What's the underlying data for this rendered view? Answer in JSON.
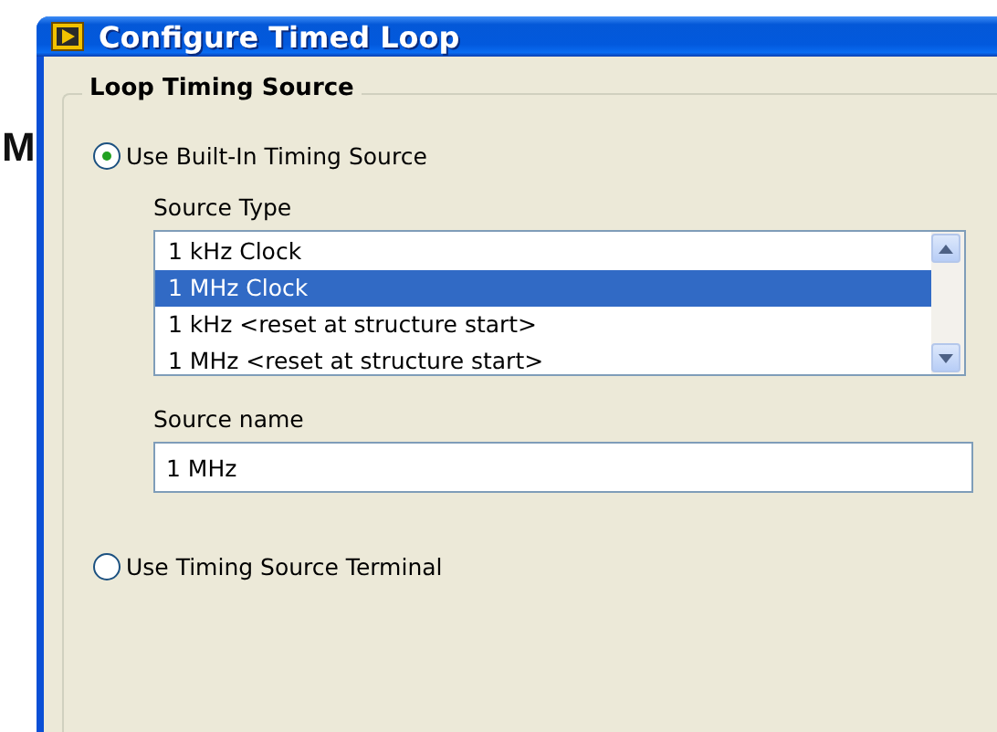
{
  "background_text": "M",
  "window": {
    "title": "Configure Timed Loop"
  },
  "group": {
    "title": "Loop Timing Source"
  },
  "options": [
    {
      "label": "Use Built-In Timing Source",
      "selected": true
    },
    {
      "label": "Use Timing Source Terminal",
      "selected": false
    }
  ],
  "source_type": {
    "label": "Source Type",
    "items": [
      {
        "label": "1 kHz Clock",
        "selected": false
      },
      {
        "label": "1 MHz Clock",
        "selected": true
      },
      {
        "label": "1 kHz <reset at structure start>",
        "selected": false
      },
      {
        "label": "1 MHz <reset at structure start>",
        "selected": false
      }
    ]
  },
  "source_name": {
    "label": "Source name",
    "value": "1 MHz"
  }
}
